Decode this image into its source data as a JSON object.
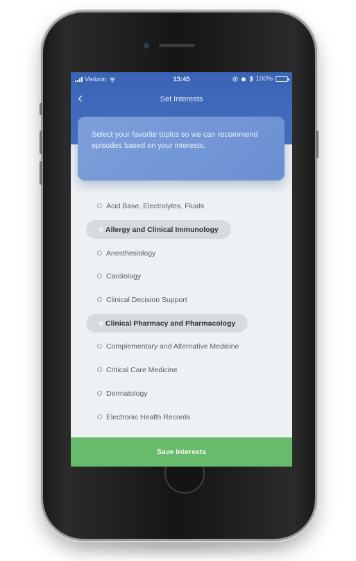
{
  "status_bar": {
    "carrier": "Verizon",
    "time": "13:45",
    "battery": "100%"
  },
  "nav": {
    "title": "Set Interests",
    "back_icon": "chevron-left-icon"
  },
  "prompt": {
    "text": "Select your favorite topics so we can recommend episodes based on your interests."
  },
  "topics": [
    {
      "label": "Acid Base, Electrolytes, Fluids",
      "selected": false
    },
    {
      "label": "Allergy and Clinical Immunology",
      "selected": true
    },
    {
      "label": "Anesthesiology",
      "selected": false
    },
    {
      "label": "Cardiology",
      "selected": false
    },
    {
      "label": "Clinical Decision Support",
      "selected": false
    },
    {
      "label": "Clinical Pharmacy and Pharmacology",
      "selected": true
    },
    {
      "label": "Complementary and Alternative Medicine",
      "selected": false
    },
    {
      "label": "Critical Care Medicine",
      "selected": false
    },
    {
      "label": "Dermatology",
      "selected": false
    },
    {
      "label": "Electronic Health Records",
      "selected": false
    }
  ],
  "save_button": {
    "label": "Save Interests"
  },
  "colors": {
    "header_blue": "#3a63b5",
    "prompt_blue": "#7d9fda",
    "save_green": "#68bb6a",
    "selected_pill": "#d6dbe0"
  }
}
